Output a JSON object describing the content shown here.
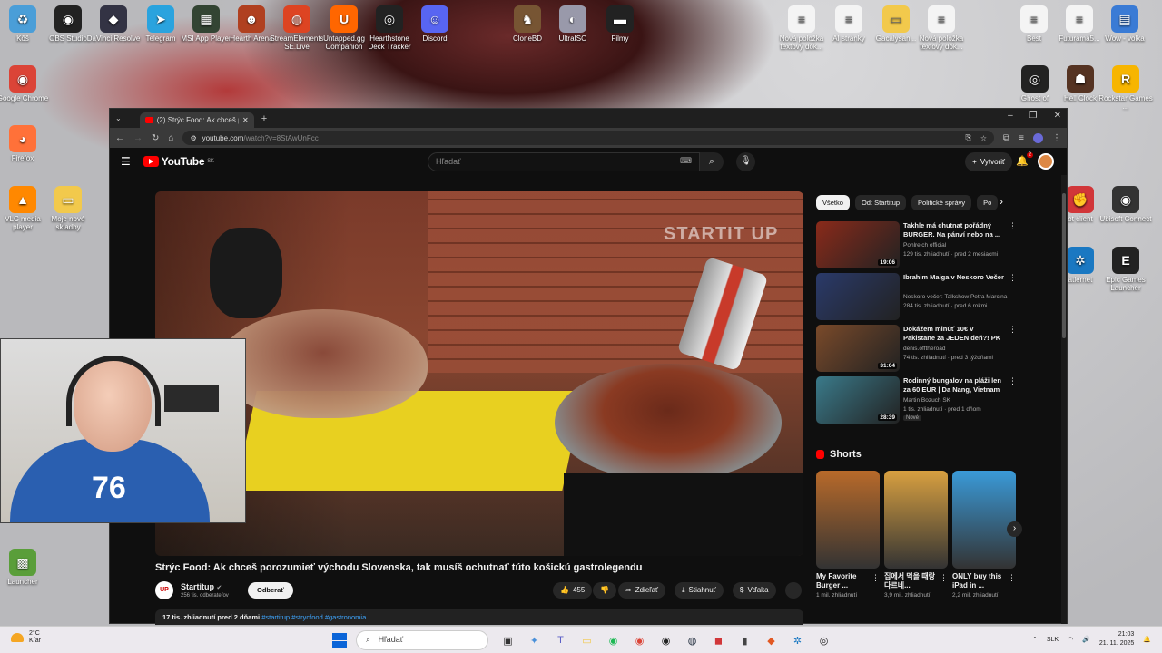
{
  "desktop": {
    "top_icons": [
      {
        "label": "Kôš",
        "icon": "recycle-bin-icon",
        "color": "#4a9ed8",
        "glyph": "♻"
      },
      {
        "label": "OBS Studio",
        "icon": "obs-icon",
        "color": "#222222",
        "glyph": "◉"
      },
      {
        "label": "DaVinci Resolve",
        "icon": "davinci-icon",
        "color": "#333344",
        "glyph": "◆"
      },
      {
        "label": "Telegram",
        "icon": "telegram-icon",
        "color": "#2aa3de",
        "glyph": "➤"
      },
      {
        "label": "MSI App Player",
        "icon": "msi-icon",
        "color": "#334433",
        "glyph": "▦"
      },
      {
        "label": "Hearth Arena",
        "icon": "hearth-arena-icon",
        "color": "#b04020",
        "glyph": "☻"
      },
      {
        "label": "StreamElements SE.Live",
        "icon": "streamelements-icon",
        "color": "#dd4422",
        "glyph": "◍"
      },
      {
        "label": "Untapped.gg Companion",
        "icon": "untapped-icon",
        "color": "#ff6600",
        "glyph": "U"
      },
      {
        "label": "Hearthstone Deck Tracker",
        "icon": "hdt-icon",
        "color": "#222222",
        "glyph": "◎"
      },
      {
        "label": "Discord",
        "icon": "discord-icon",
        "color": "#5865f2",
        "glyph": "☺"
      },
      {
        "label": "CloneBD",
        "icon": "clonebd-icon",
        "color": "#775533",
        "glyph": "♞"
      },
      {
        "label": "UltraISO",
        "icon": "ultraiso-icon",
        "color": "#9999aa",
        "glyph": "◐"
      },
      {
        "label": "Filmy",
        "icon": "film-folder-icon",
        "color": "#222222",
        "glyph": "▬"
      },
      {
        "label": "Nová položka textový dok...",
        "icon": "text-doc-icon",
        "color": "#f4f4f4",
        "glyph": "≡"
      },
      {
        "label": "AI stránky",
        "icon": "text-doc-icon",
        "color": "#f4f4f4",
        "glyph": "≡"
      },
      {
        "label": "Gacalysan...",
        "icon": "folder-icon",
        "color": "#f2c94c",
        "glyph": "▭"
      },
      {
        "label": "Nová položka textový dok...",
        "icon": "text-doc-icon",
        "color": "#f4f4f4",
        "glyph": "≡"
      },
      {
        "label": "Best",
        "icon": "text-doc-icon",
        "color": "#f4f4f4",
        "glyph": "≡"
      },
      {
        "label": "Futurama5...",
        "icon": "text-doc-icon",
        "color": "#f4f4f4",
        "glyph": "≡"
      },
      {
        "label": "Wow - volka",
        "icon": "doc-icon",
        "color": "#3a7bd5",
        "glyph": "▤"
      }
    ],
    "left_icons": [
      {
        "label": "Google Chrome",
        "icon": "chrome-icon",
        "color": "#db4437",
        "glyph": "◉"
      },
      {
        "label": "Firefox",
        "icon": "firefox-icon",
        "color": "#ff7139",
        "glyph": "◕"
      },
      {
        "label": "VLC media player",
        "icon": "vlc-icon",
        "color": "#ff8800",
        "glyph": "▲"
      },
      {
        "label": "Moje nové skladby",
        "icon": "folder-icon",
        "color": "#f2c94c",
        "glyph": "▭"
      },
      {
        "label": "Launcher",
        "icon": "minecraft-icon",
        "color": "#5a9e3a",
        "glyph": "▩"
      }
    ],
    "right_icons": [
      {
        "label": "Ghost of",
        "icon": "ghost-icon",
        "color": "#222222",
        "glyph": "◎"
      },
      {
        "label": "Hell Clock",
        "icon": "hellclock-icon",
        "color": "#553322",
        "glyph": "☗"
      },
      {
        "label": "Rockstar Games ...",
        "icon": "rockstar-icon",
        "color": "#f7b500",
        "glyph": "R"
      },
      {
        "label": "ot client",
        "icon": "riot-icon",
        "color": "#d13639",
        "glyph": "✊"
      },
      {
        "label": "Ubisoft Connect",
        "icon": "ubisoft-icon",
        "color": "#333333",
        "glyph": "◉"
      },
      {
        "label": "atlernet",
        "icon": "network-icon",
        "color": "#1a78c2",
        "glyph": "✲"
      },
      {
        "label": "Epic Games Launcher",
        "icon": "epic-icon",
        "color": "#222222",
        "glyph": "E"
      }
    ]
  },
  "browser": {
    "tab_title": "(2) Strýc Food: Ak chceš porozu...",
    "url_host": "youtube.com",
    "url_path": "/watch?v=8StAwUnFcc"
  },
  "youtube": {
    "country": "SK",
    "logo_text": "YouTube",
    "search_placeholder": "Hľadať",
    "create_label": "Vytvoriť",
    "notif_count": "2",
    "video": {
      "watermark": "STARTIT UP",
      "title": "Strýc Food: Ak chceš porozumieť východu Slovenska, tak musíš ochutnať túto košickú gastrolegendu",
      "channel": "Startitup",
      "channel_avatar": "UP",
      "subscribers": "256 tis. odberateľov",
      "subscribe_label": "Odberať",
      "likes": "455",
      "share_label": "Zdieľať",
      "download_label": "Stiahnuť",
      "thanks_label": "Vďaka",
      "meta": "17 tis. zhliadnutí  pred 2 dňami",
      "tags": "#startitup #strycfood #gastronomia"
    },
    "chips": [
      "Všetko",
      "Od: Startitup",
      "Politické správy",
      "Po"
    ],
    "recommendations": [
      {
        "title": "Takhle má chutnat pořádný BURGER. Na pánví nebo na ...",
        "channel": "Pohlreich official",
        "meta": "129 tis. zhliadnutí · pred 2 mesiacmi",
        "duration": "19:06",
        "badge": "",
        "thumb_color": "#8a2a1a"
      },
      {
        "title": "Ibrahim Maiga v Neskoro Večer",
        "channel": "Neskoro večer: Talkshow Petra Marcina",
        "meta": "284 tis. zhliadnutí · pred 6 rokmi",
        "duration": "",
        "badge": "",
        "thumb_color": "#2a3a6a"
      },
      {
        "title": "Dokážem minúť 10€ v Pakistane za JEDEN deň?! PK",
        "channel": "denis.offtheroad",
        "meta": "74 tis. zhliadnutí · pred 3 týždňami",
        "duration": "31:04",
        "badge": "",
        "thumb_color": "#7a4a2a"
      },
      {
        "title": "Rodinný bungalov na pláži len za 60 EUR | Da Nang, Vietnam",
        "channel": "Martin Bozuch SK",
        "meta": "1 tis. zhliadnutí · pred 1 dňom",
        "duration": "28:39",
        "badge": "Nové",
        "thumb_color": "#3a7a8a"
      }
    ],
    "shorts_label": "Shorts",
    "shorts": [
      {
        "title": "My Favorite Burger ...",
        "views": "1 mil. zhliadnutí",
        "thumb_color": "#b86a2a"
      },
      {
        "title": "집에서 먹을 때랑 다르네...",
        "views": "3,9 mil. zhliadnutí",
        "thumb_color": "#d8a040"
      },
      {
        "title": "ONLY buy this iPad in ...",
        "views": "2,2 mil. zhliadnutí",
        "thumb_color": "#3a9ad8"
      }
    ]
  },
  "webcam": {
    "jersey_number": "76"
  },
  "taskbar": {
    "weather_temp": "2°C",
    "weather_desc": "Kľar",
    "search_placeholder": "Hľadať",
    "language": "SLK",
    "time": "21:03",
    "date": "21. 11. 2025",
    "apps": [
      {
        "icon": "task-view-icon",
        "glyph": "▣",
        "color": "#333333"
      },
      {
        "icon": "widget-icon",
        "glyph": "✦",
        "color": "#4a90d9"
      },
      {
        "icon": "teams-icon",
        "glyph": "T",
        "color": "#5b5fc7"
      },
      {
        "icon": "file-explorer-icon",
        "glyph": "▭",
        "color": "#f2c94c"
      },
      {
        "icon": "spotify-icon",
        "glyph": "◉",
        "color": "#1db954"
      },
      {
        "icon": "chrome-icon",
        "glyph": "◉",
        "color": "#db4437"
      },
      {
        "icon": "obs-icon",
        "glyph": "◉",
        "color": "#222222"
      },
      {
        "icon": "steam-icon",
        "glyph": "◍",
        "color": "#1b2838"
      },
      {
        "icon": "app-red-icon",
        "glyph": "◼",
        "color": "#d13639"
      },
      {
        "icon": "app-bar-icon",
        "glyph": "▮",
        "color": "#444444"
      },
      {
        "icon": "game-icon",
        "glyph": "◆",
        "color": "#e25822"
      },
      {
        "icon": "network-icon",
        "glyph": "✲",
        "color": "#1a78c2"
      },
      {
        "icon": "hdt-icon",
        "glyph": "◎",
        "color": "#222222"
      }
    ]
  }
}
